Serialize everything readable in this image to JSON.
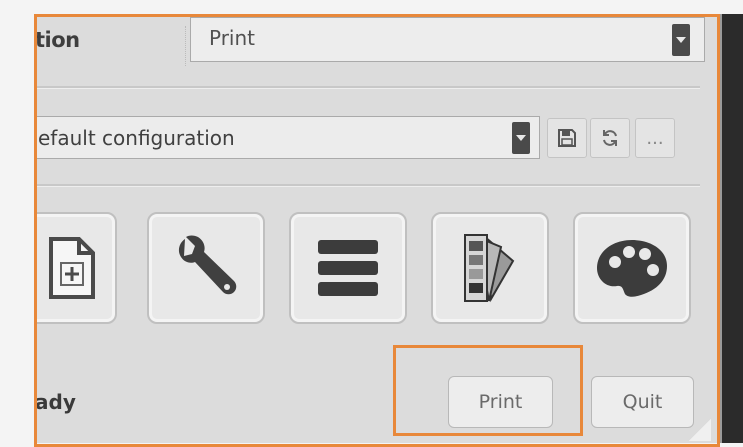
{
  "action_row": {
    "label": "tion",
    "selected": "Print"
  },
  "config_row": {
    "selected": "efault configuration",
    "icons": [
      "save-icon",
      "refresh-icon",
      "more-icon"
    ],
    "more_label": "..."
  },
  "tools": [
    {
      "name": "new-document-icon"
    },
    {
      "name": "wrench-icon"
    },
    {
      "name": "list-icon"
    },
    {
      "name": "color-swatch-icon"
    },
    {
      "name": "palette-icon"
    }
  ],
  "status": {
    "text": "ady"
  },
  "buttons": {
    "print_label": "Print",
    "quit_label": "Quit"
  },
  "colors": {
    "highlight": "#e8883a",
    "icon": "#404040"
  }
}
